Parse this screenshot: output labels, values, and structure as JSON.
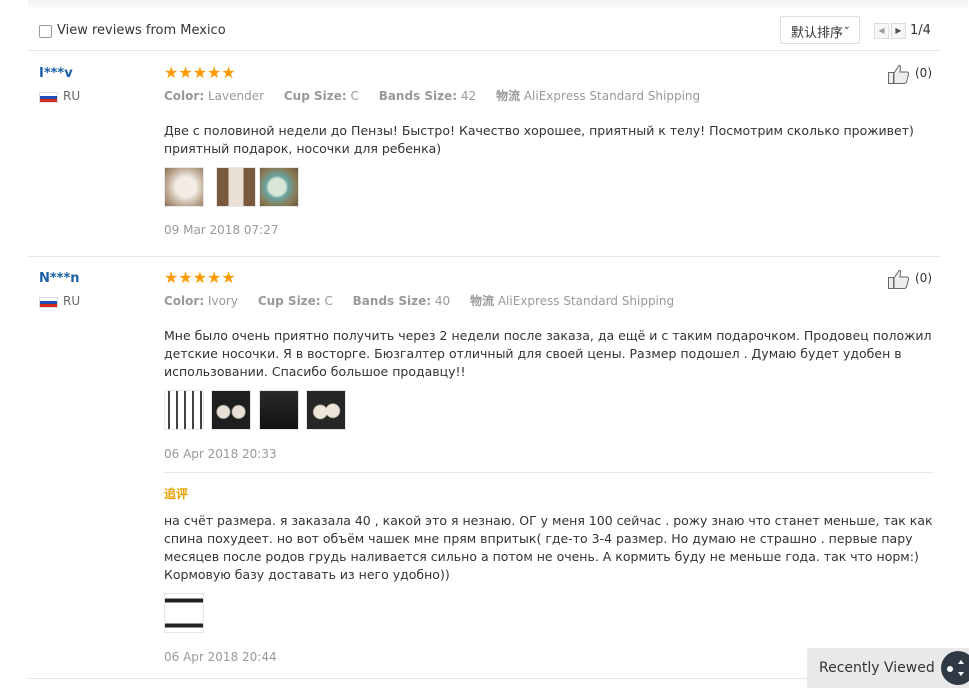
{
  "filter": {
    "checkbox_label": "View reviews from Mexico",
    "sort_label": "默认排序",
    "pager_text": "1/4"
  },
  "reviews": [
    {
      "user": "I***v",
      "country": "RU",
      "rating": 5,
      "stars": "★★★★★",
      "color_key": "Color:",
      "color_val": "Lavender",
      "cup_key": "Cup Size:",
      "cup_val": "C",
      "band_key": "Bands Size:",
      "band_val": "42",
      "ship_key": "物流",
      "ship_val": "AliExpress Standard Shipping",
      "likes": "(0)",
      "text": "Две с половиной недели до Пензы! Быстро! Качество хорошее, приятный к телу! Посмотрим сколько проживет) приятный подарок, носочки для ребенка)",
      "date": "09 Mar 2018 07:27"
    },
    {
      "user": "N***n",
      "country": "RU",
      "rating": 5,
      "stars": "★★★★★",
      "color_key": "Color:",
      "color_val": "Ivory",
      "cup_key": "Cup Size:",
      "cup_val": "C",
      "band_key": "Bands Size:",
      "band_val": "40",
      "ship_key": "物流",
      "ship_val": "AliExpress Standard Shipping",
      "likes": "(0)",
      "text": "Мне было очень приятно получить через 2 недели после заказа, да ещё и с таким подарочком. Продовец положил детские носочки. Я в восторге. Бюзгалтер отличный для своей цены. Размер подошел . Думаю будет удобен в использовании. Спасибо большое продавцу!!",
      "date": "06 Apr 2018 20:33",
      "followup_label": "追评",
      "followup_text": "на счёт размера. я заказала 40 , какой это я незнаю. ОГ у меня 100 сейчас . рожу знаю что станет меньше, так как спина похудеет. но вот объём чашек мне прям впритык( где-то 3-4 размер. Но думаю не страшно . первые пару месяцев после родов грудь наливается сильно а потом не очень. А кормить буду не меньше года. так что норм:) Кормовую базу доставать из него удобно))",
      "followup_date": "06 Apr 2018 20:44"
    }
  ],
  "recently_viewed": {
    "label": "Recently Viewed"
  }
}
